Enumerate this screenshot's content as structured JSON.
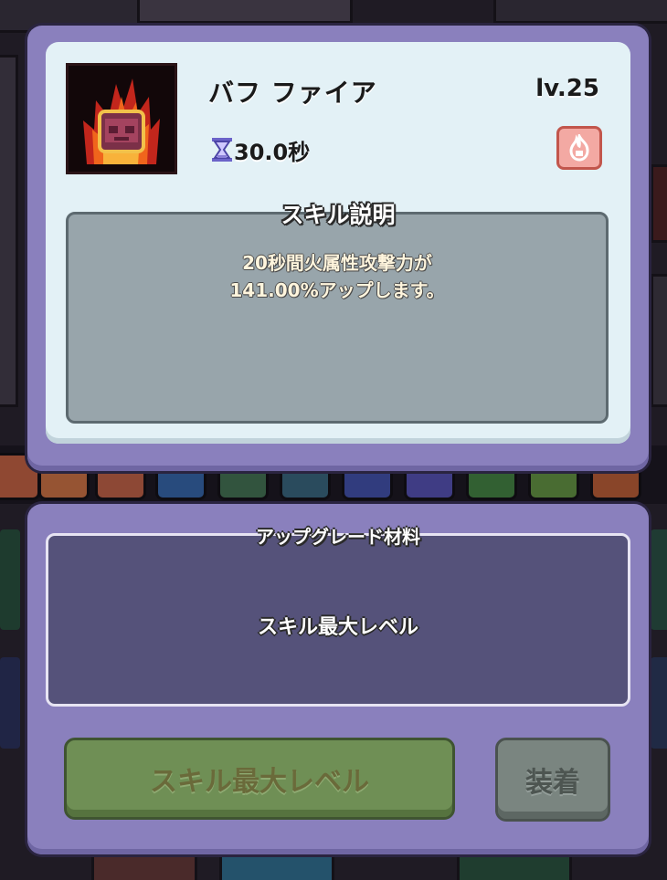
{
  "skill": {
    "name": "バフ ファイア",
    "level": "lv.25",
    "cooldown": "30.0秒",
    "icon": "fire-skill-icon",
    "element_icon": "fire-element-icon"
  },
  "description": {
    "title": "スキル説明",
    "line1": "20秒間火属性攻撃力が",
    "line2": "141.00%アップします。"
  },
  "upgrade": {
    "title": "アップグレード材料",
    "status": "スキル最大レベル"
  },
  "buttons": {
    "max_level": "スキル最大レベル",
    "equip": "装着"
  },
  "colors": {
    "panel": "#8a80bd",
    "card": "#e3f1f6",
    "desc_box": "#98a5ab",
    "material_box": "#55527a",
    "max_button": "#6f8f55",
    "equip_button": "#7a8580"
  }
}
